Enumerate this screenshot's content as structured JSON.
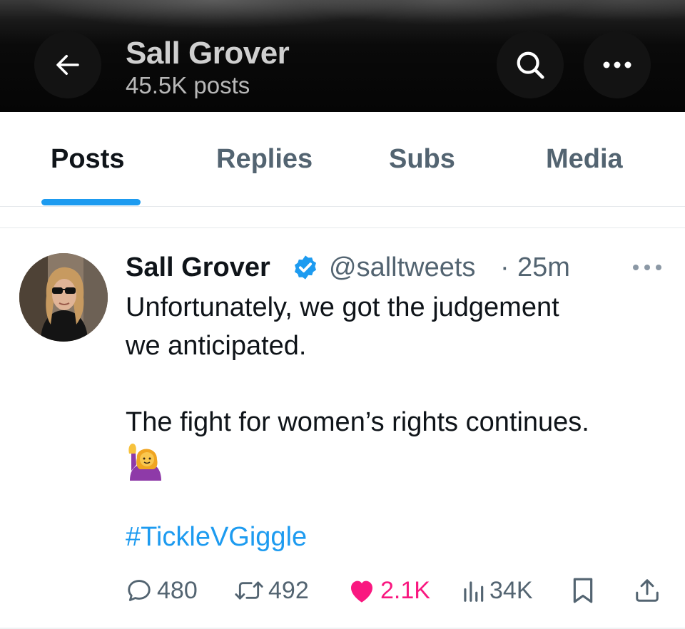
{
  "header": {
    "title": "Sall Grover",
    "subtitle": "45.5K posts",
    "icons": [
      "back-arrow-icon",
      "search-icon",
      "more-icon"
    ]
  },
  "tabs": [
    {
      "label": "Posts",
      "active": true
    },
    {
      "label": "Replies",
      "active": false
    },
    {
      "label": "Subs",
      "active": false
    },
    {
      "label": "Media",
      "active": false
    }
  ],
  "tweet": {
    "author_name": "Sall Grover",
    "handle": "@salltweets",
    "separator": "·",
    "time": "25m",
    "lines": [
      "Unfortunately, we got the judgement",
      "we anticipated.",
      "The fight for women’s rights continues."
    ],
    "emoji": "person-raising-hand",
    "hashtag": "#TickleVGiggle",
    "actions": {
      "replies": "480",
      "reposts": "492",
      "likes": "2.1K",
      "views": "34K"
    }
  },
  "colors": {
    "accent": "#1d9bf0",
    "like": "#f91880",
    "muted": "#536471",
    "text": "#0f1419"
  }
}
